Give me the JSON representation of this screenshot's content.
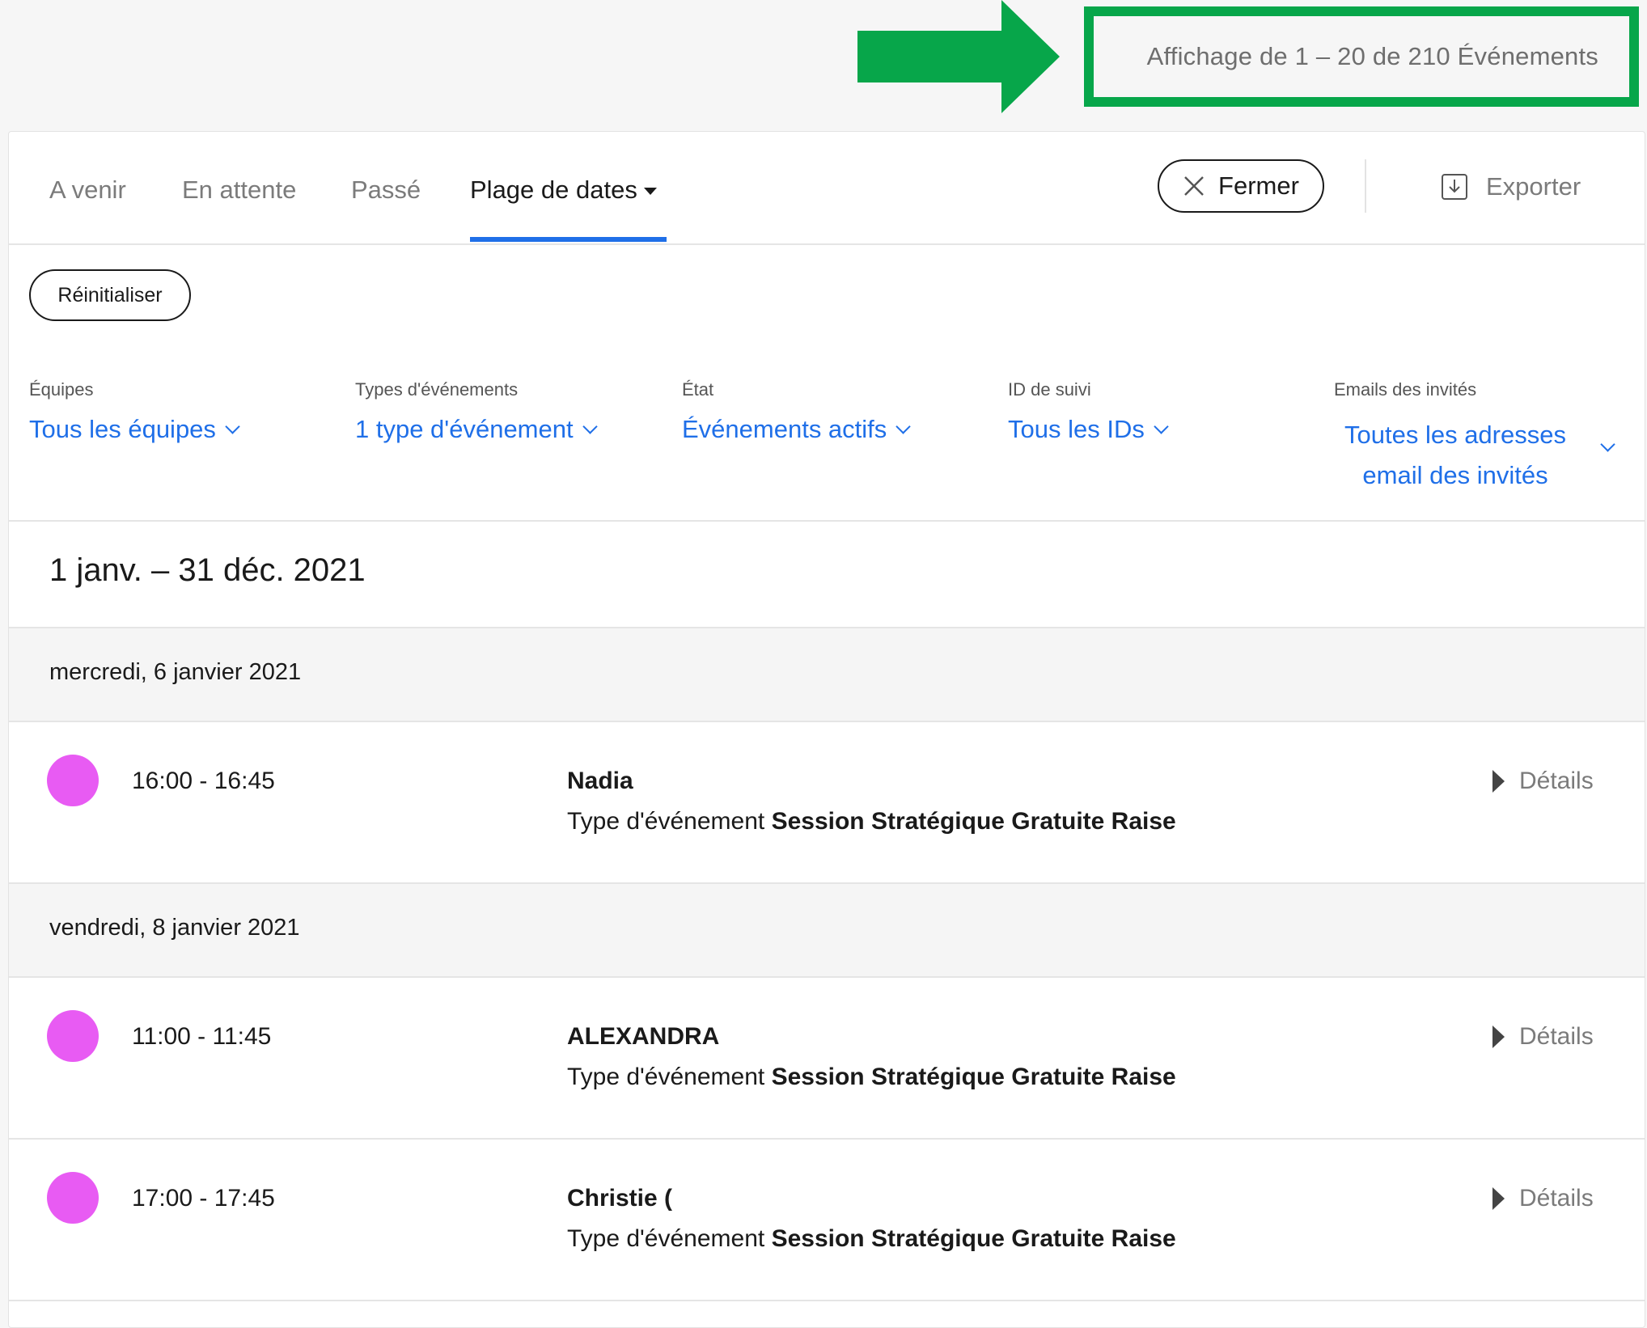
{
  "header": {
    "count_text": "Affichage de 1 – 20 de 210 Événements",
    "highlight_color": "#07a64a"
  },
  "tabs": [
    {
      "label": "A venir",
      "active": false
    },
    {
      "label": "En attente",
      "active": false
    },
    {
      "label": "Passé",
      "active": false
    },
    {
      "label": "Plage de dates",
      "active": true
    }
  ],
  "toolbar": {
    "close_label": "Fermer",
    "export_label": "Exporter",
    "reset_label": "Réinitialiser"
  },
  "filters": [
    {
      "label": "Équipes",
      "value": "Tous les équipes"
    },
    {
      "label": "Types d'événements",
      "value": "1 type d'événement"
    },
    {
      "label": "État",
      "value": "Événements actifs"
    },
    {
      "label": "ID de suivi",
      "value": "Tous les IDs"
    },
    {
      "label": "Emails des invités",
      "value_line1": "Toutes les adresses",
      "value_line2": "email des invités"
    }
  ],
  "range_title": "1 janv. – 31 déc. 2021",
  "days": [
    {
      "date": "mercredi, 6 janvier 2021"
    },
    {
      "date": "vendredi, 8 janvier 2021"
    }
  ],
  "events": [
    {
      "time": "16:00 - 16:45",
      "name": "Nadia",
      "type_prefix": "Type d'événement",
      "type_name": "Session Stratégique Gratuite Raise",
      "details": "Détails",
      "color": "#e85bf3"
    },
    {
      "time": "11:00 - 11:45",
      "name": "ALEXANDRA",
      "type_prefix": "Type d'événement",
      "type_name": "Session Stratégique Gratuite Raise",
      "details": "Détails",
      "color": "#e85bf3"
    },
    {
      "time": "17:00 - 17:45",
      "name": "Christie (",
      "type_prefix": "Type d'événement",
      "type_name": "Session Stratégique Gratuite Raise",
      "details": "Détails",
      "color": "#e85bf3"
    }
  ],
  "accent_color": "#1f6fe8"
}
